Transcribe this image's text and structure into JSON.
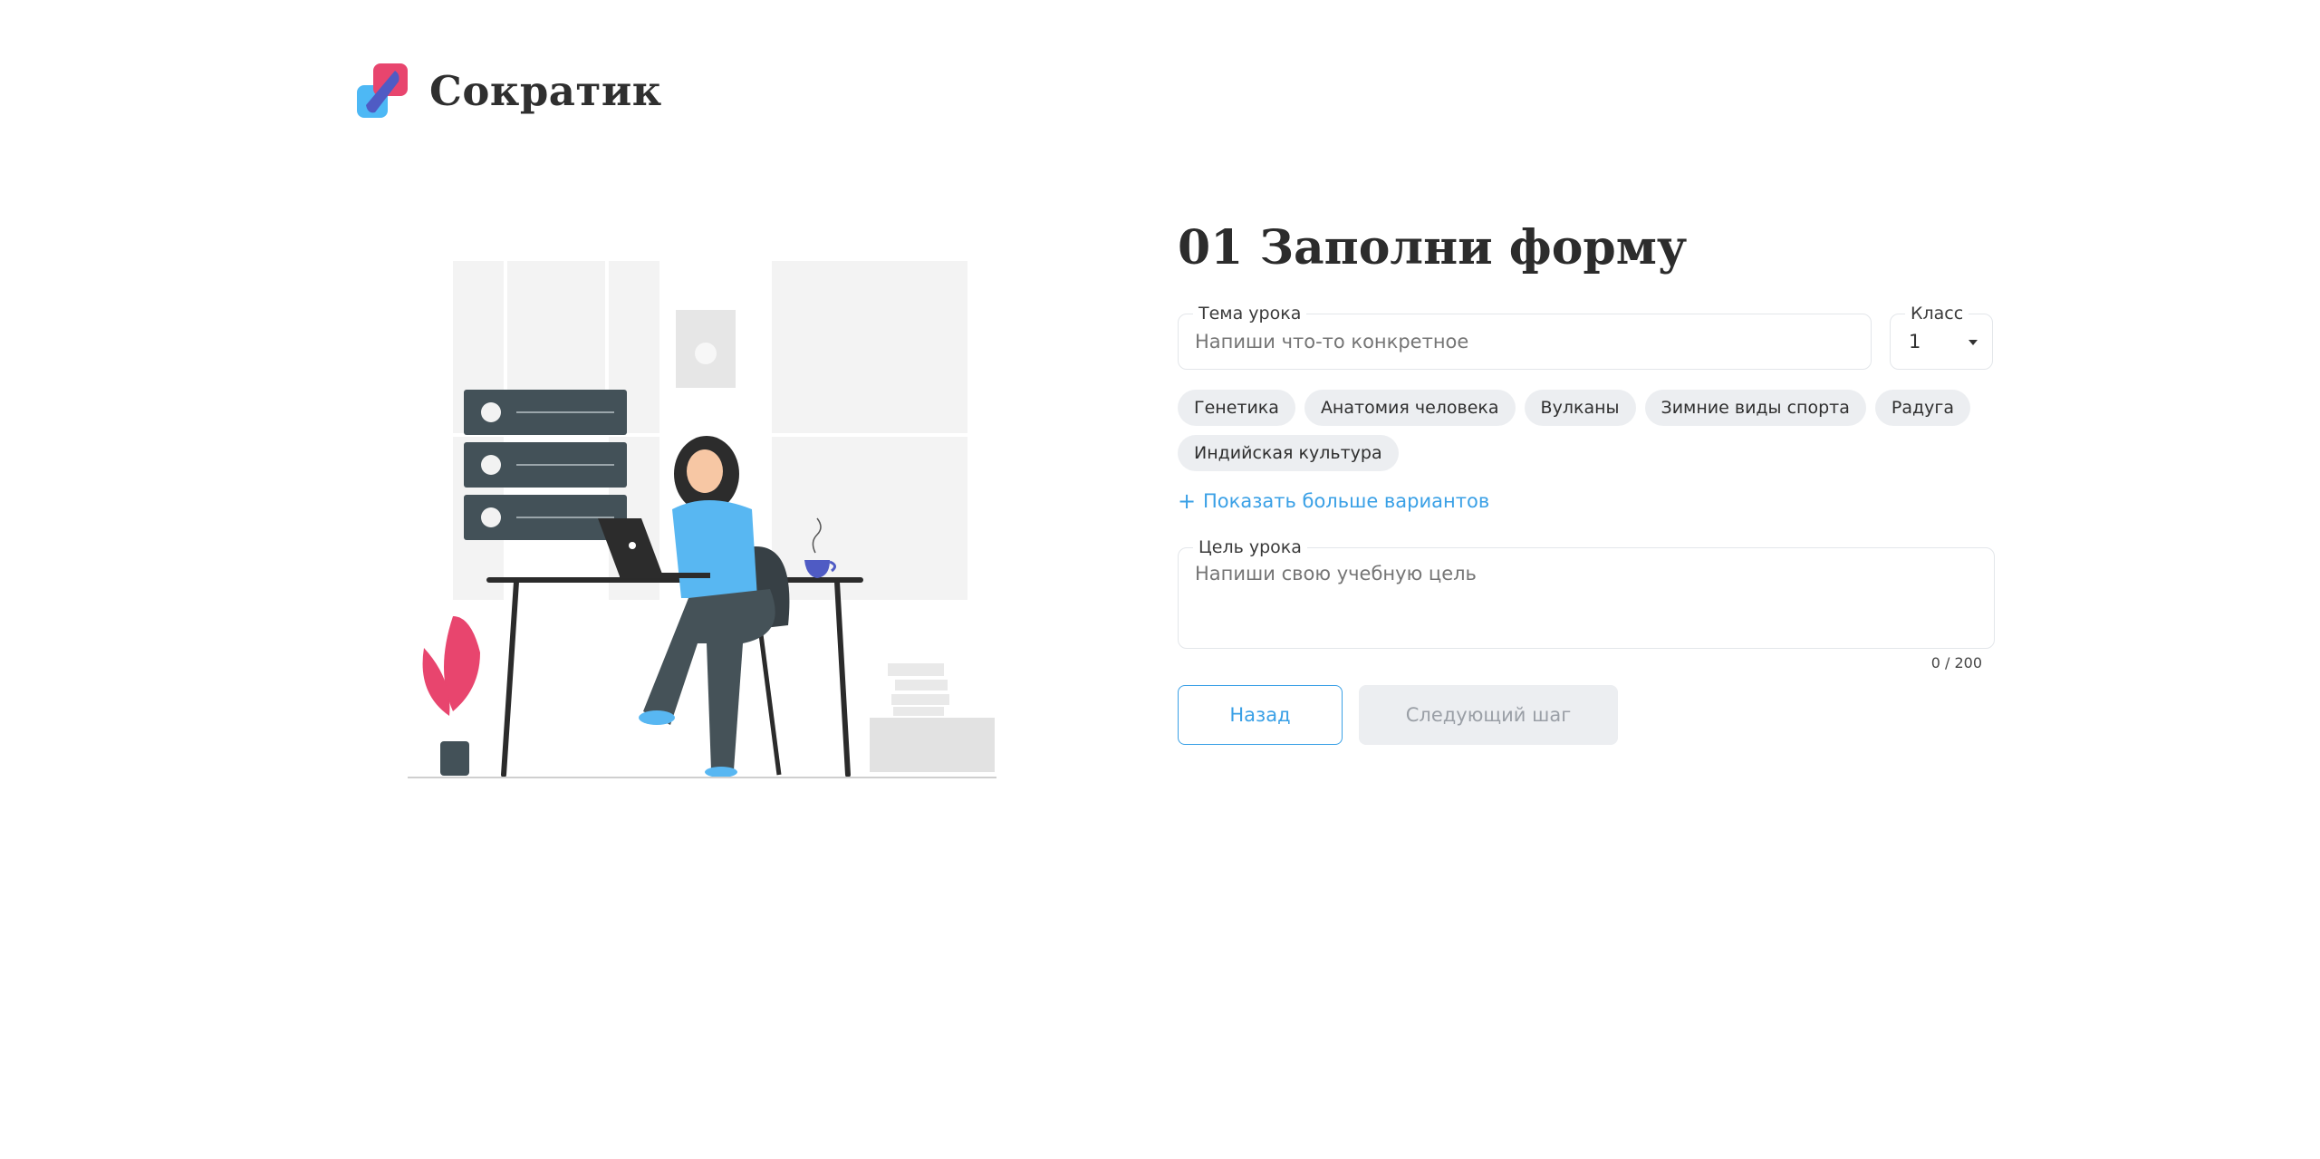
{
  "brand": {
    "name": "Сократик",
    "colors": {
      "pink": "#e8456e",
      "blue": "#4db8f5",
      "indigo": "#4f5bc4"
    }
  },
  "form": {
    "title": "01 Заполни форму",
    "topic": {
      "label": "Тема урока",
      "placeholder": "Напиши что-то конкретное",
      "value": ""
    },
    "grade": {
      "label": "Класс",
      "value": "1"
    },
    "suggestions": [
      "Генетика",
      "Анатомия человека",
      "Вулканы",
      "Зимние виды спорта",
      "Радуга",
      "Индийская культура"
    ],
    "show_more_label": "Показать больше вариантов",
    "goal": {
      "label": "Цель урока",
      "placeholder": "Напиши свою учебную цель",
      "counter": "0 / 200"
    },
    "buttons": {
      "back_label": "Назад",
      "next_label": "Следующий шаг"
    }
  },
  "colors": {
    "accent": "#3aa0e6",
    "chip_bg": "#eceef1",
    "disabled_text": "#9a9fa6"
  },
  "icons": {
    "logo": "sokratik-logo-icon",
    "plus": "plus-icon",
    "caret": "chevron-down-icon"
  }
}
